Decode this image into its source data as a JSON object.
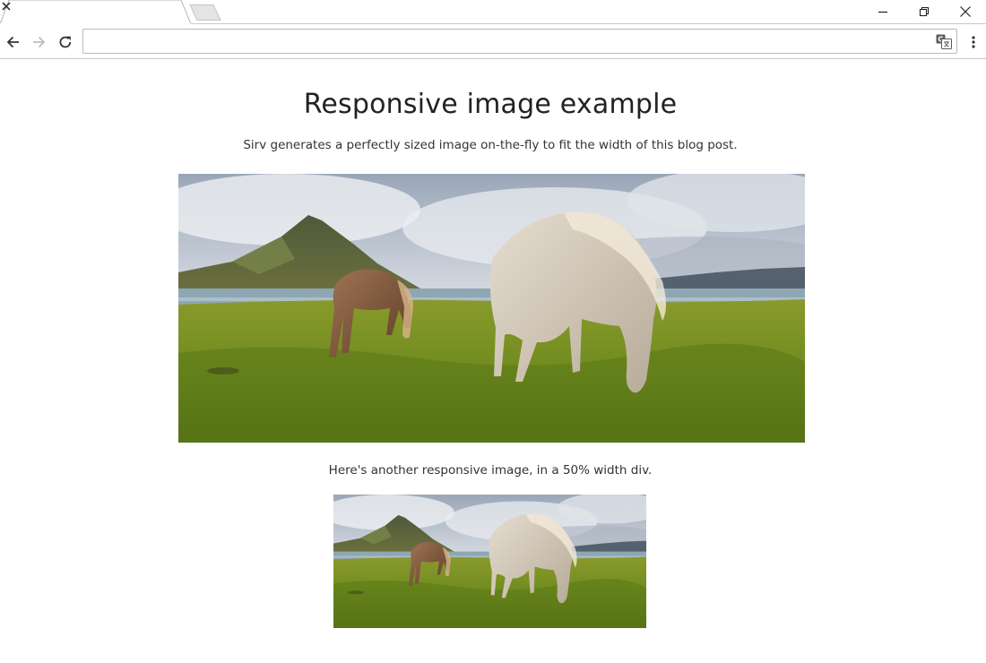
{
  "browser": {
    "tab_title": "",
    "address_value": "",
    "address_placeholder": ""
  },
  "page": {
    "title": "Responsive image example",
    "intro": "Sirv generates a perfectly sized image on-the-fly to fit the width of this blog post.",
    "second_caption": "Here's another responsive image, in a 50% width div."
  },
  "images": [
    {
      "name": "horses-grazing-hero",
      "icon": "landscape-photo"
    },
    {
      "name": "horses-grazing-half",
      "icon": "landscape-photo"
    }
  ],
  "colors": {
    "chrome_border": "#c8c8c8",
    "title_text": "#222222",
    "body_text": "#333333"
  }
}
